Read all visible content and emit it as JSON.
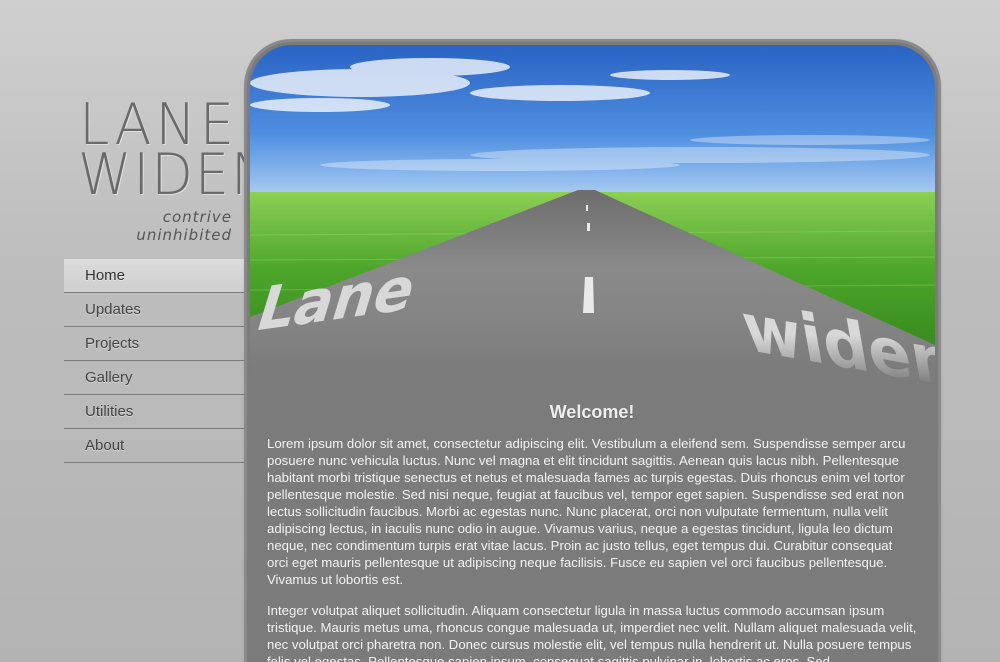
{
  "logo": {
    "line1": "LANE",
    "line2": "WIDEN",
    "tagline": "contrive uninhibited"
  },
  "nav": {
    "items": [
      {
        "label": "Home",
        "active": true
      },
      {
        "label": "Updates"
      },
      {
        "label": "Projects"
      },
      {
        "label": "Gallery"
      },
      {
        "label": "Utilities"
      },
      {
        "label": "About"
      }
    ]
  },
  "banner": {
    "road_text_left": "Lane",
    "road_text_right": "widen"
  },
  "main": {
    "heading": "Welcome!",
    "paragraph1": "Lorem ipsum dolor sit amet, consectetur adipiscing elit. Vestibulum a eleifend sem. Suspendisse semper arcu posuere nunc vehicula luctus. Nunc vel magna et elit tincidunt sagittis. Aenean quis lacus nibh. Pellentesque habitant morbi tristique senectus et netus et malesuada fames ac turpis egestas. Duis rhoncus enim vel tortor pellentesque molestie. Sed nisi neque, feugiat at faucibus vel, tempor eget sapien. Suspendisse sed erat non lectus sollicitudin faucibus. Morbi ac egestas nunc. Nunc placerat, orci non vulputate fermentum, nulla velit adipiscing lectus, in iaculis nunc odio in augue. Vivamus varius, neque a egestas tincidunt, ligula leo dictum neque, nec condimentum turpis erat vitae lacus. Proin ac justo tellus, eget tempus dui. Curabitur consequat orci eget mauris pellentesque ut adipiscing neque facilisis. Fusce eu sapien vel orci faucibus pellentesque. Vivamus ut lobortis est.",
    "paragraph2": "Integer volutpat aliquet sollicitudin. Aliquam consectetur ligula in massa luctus commodo accumsan ipsum tristique. Mauris metus uma, rhoncus congue malesuada ut, imperdiet nec velit. Nullam aliquet malesuada velit, nec volutpat orci pharetra non. Donec cursus molestie elit, vel tempus nulla hendrerit ut. Nulla posuere tempus felis vel egestas. Pellentesque sapien ipsum, consequat sagittis pulvinar in, lobortis ac eros. Sed"
  },
  "colors": {
    "panel": "#7b7b7b",
    "sky": "#3f7ed6",
    "grass": "#4fa52a",
    "road": "#8e8e8e"
  }
}
